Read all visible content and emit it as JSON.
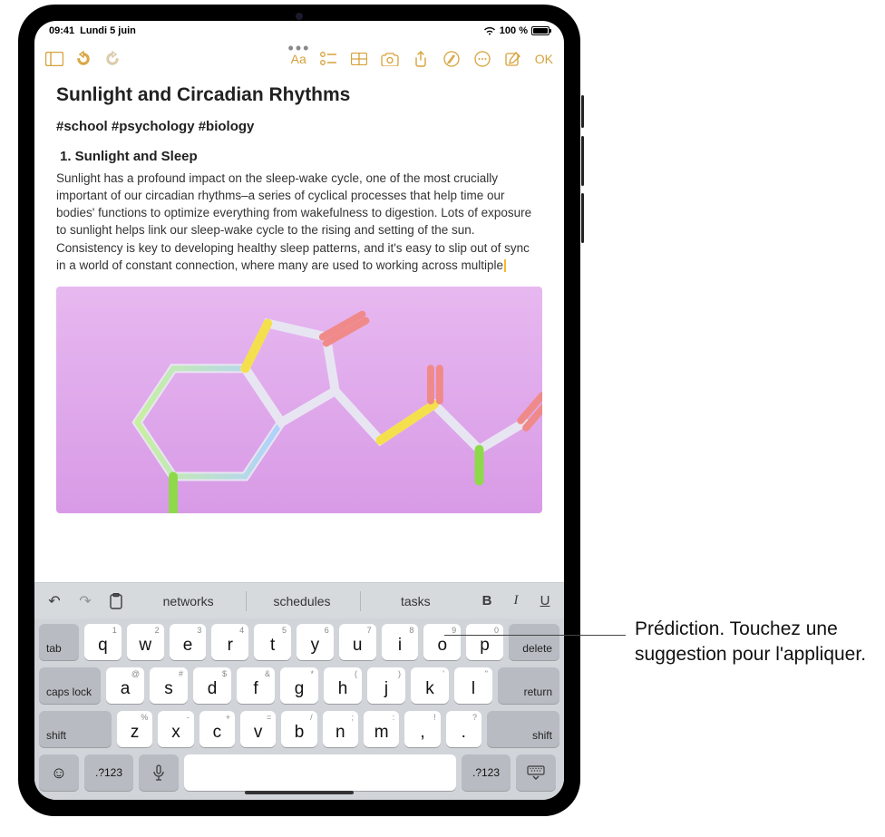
{
  "status": {
    "time": "09:41",
    "date": "Lundi 5 juin",
    "battery_pct": "100 %",
    "wifi_icon": "wifi"
  },
  "toolbar": {
    "ok_label": "OK"
  },
  "note": {
    "title": "Sunlight and Circadian Rhythms",
    "tags": "#school #psychology #biology",
    "heading": "1. Sunlight and Sleep",
    "body": "Sunlight has a profound impact on the sleep-wake cycle, one of the most crucially important of our circadian rhythms–a series of cyclical processes that help time our bodies' functions to optimize everything from wakefulness to digestion. Lots of exposure to sunlight helps link our sleep-wake cycle to the rising and setting of the sun. Consistency is key to developing healthy sleep patterns, and it's easy to slip out of sync in a world of constant connection, where many are used to working across multiple"
  },
  "predictions": [
    "networks",
    "schedules",
    "tasks"
  ],
  "format": {
    "bold": "B",
    "italic": "I",
    "underline": "U"
  },
  "keyboard": {
    "row1": [
      {
        "main": "q",
        "alt": "1"
      },
      {
        "main": "w",
        "alt": "2"
      },
      {
        "main": "e",
        "alt": "3"
      },
      {
        "main": "r",
        "alt": "4"
      },
      {
        "main": "t",
        "alt": "5"
      },
      {
        "main": "y",
        "alt": "6"
      },
      {
        "main": "u",
        "alt": "7"
      },
      {
        "main": "i",
        "alt": "8"
      },
      {
        "main": "o",
        "alt": "9"
      },
      {
        "main": "p",
        "alt": "0"
      }
    ],
    "row2": [
      {
        "main": "a",
        "alt": "@"
      },
      {
        "main": "s",
        "alt": "#"
      },
      {
        "main": "d",
        "alt": "$"
      },
      {
        "main": "f",
        "alt": "&"
      },
      {
        "main": "g",
        "alt": "*"
      },
      {
        "main": "h",
        "alt": "("
      },
      {
        "main": "j",
        "alt": ")"
      },
      {
        "main": "k",
        "alt": "'"
      },
      {
        "main": "l",
        "alt": "\""
      }
    ],
    "row3": [
      {
        "main": "z",
        "alt": "%"
      },
      {
        "main": "x",
        "alt": "-"
      },
      {
        "main": "c",
        "alt": "+"
      },
      {
        "main": "v",
        "alt": "="
      },
      {
        "main": "b",
        "alt": "/"
      },
      {
        "main": "n",
        "alt": ";"
      },
      {
        "main": "m",
        "alt": ":"
      },
      {
        "main": ",",
        "alt": "!"
      },
      {
        "main": ".",
        "alt": "?"
      }
    ],
    "tab": "tab",
    "delete": "delete",
    "caps": "caps lock",
    "return": "return",
    "shift": "shift",
    "numbers": ".?123"
  },
  "callout": {
    "text": "Prédiction. Touchez une suggestion pour l'appliquer."
  }
}
